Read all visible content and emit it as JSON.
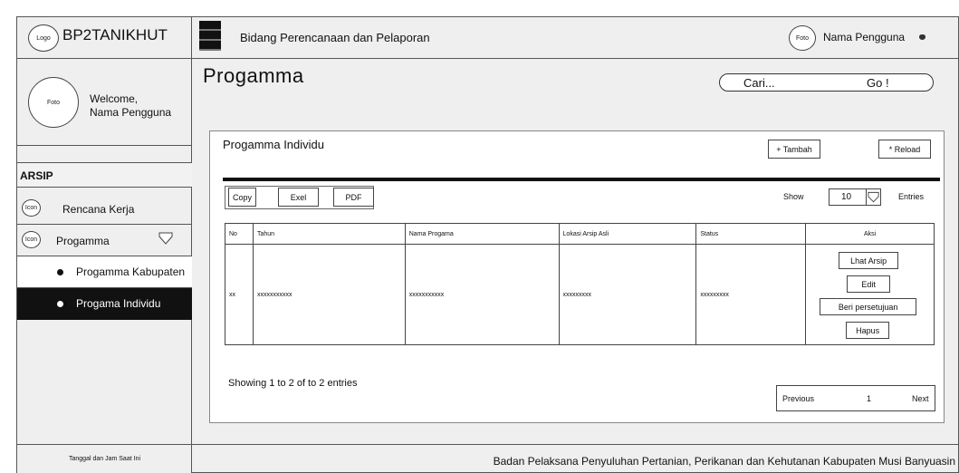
{
  "brand": {
    "logo_label": "Logo",
    "name": "BP2TANIKHUT"
  },
  "profile": {
    "photo_label": "Foto",
    "welcome": "Welcome,",
    "user": "Nama Pengguna"
  },
  "sidebar": {
    "section": "ARSIP",
    "items": [
      {
        "icon_label": "Icon",
        "label": "Rencana Kerja"
      },
      {
        "icon_label": "Icon",
        "label": "Progamma"
      }
    ],
    "subitems": [
      {
        "label": "Progamma Kabupaten"
      },
      {
        "label": "Progama Individu",
        "active": true
      }
    ],
    "datetime": "Tanggal dan Jam Saat Ini"
  },
  "topbar": {
    "division": "Bidang Perencanaan dan Pelaporan",
    "photo_label": "Foto",
    "user": "Nama Pengguna"
  },
  "page": {
    "title": "Progamma"
  },
  "search": {
    "placeholder": "Cari...",
    "go": "Go !"
  },
  "panel": {
    "title": "Progamma Individu",
    "add": "+ Tambah",
    "reload": "* Reload",
    "export": {
      "copy": "Copy",
      "excel": "Exel",
      "pdf": "PDF"
    },
    "show": "Show",
    "page_size": "10",
    "entries": "Entries"
  },
  "table": {
    "headers": [
      "No",
      "Tahun",
      "Nama Progama",
      "Lokasi Arsip Asli",
      "Status",
      "Aksi"
    ],
    "rows": [
      [
        "xx",
        "xxxxxxxxxxx",
        "xxxxxxxxxxx",
        "xxxxxxxxx",
        "xxxxxxxxx"
      ]
    ],
    "actions": [
      "Lhat Arsip",
      "Edit",
      "Beri persetujuan",
      "Hapus"
    ]
  },
  "pagination": {
    "summary": "Showing 1 to 2 of to 2 entries",
    "previous": "Previous",
    "current": "1",
    "next": "Next"
  },
  "footer": {
    "org": "Badan Pelaksana Penyuluhan Pertanian, Perikanan dan Kehutanan Kabupaten Musi Banyuasin"
  }
}
